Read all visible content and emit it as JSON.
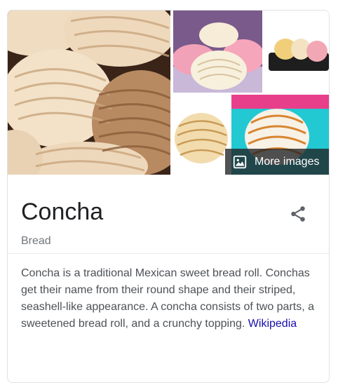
{
  "knowledge_panel": {
    "gallery": {
      "more_images_label": "More images",
      "more_images_icon": "image-icon"
    },
    "title": "Concha",
    "subtitle": "Bread",
    "share_icon": "share-icon",
    "description": "Concha is a traditional Mexican sweet bread roll. Conchas get their name from their round shape and their striped, seashell-like appearance. A concha consists of two parts, a sweetened bread roll, and a crunchy topping.",
    "source_link": "Wikipedia"
  }
}
